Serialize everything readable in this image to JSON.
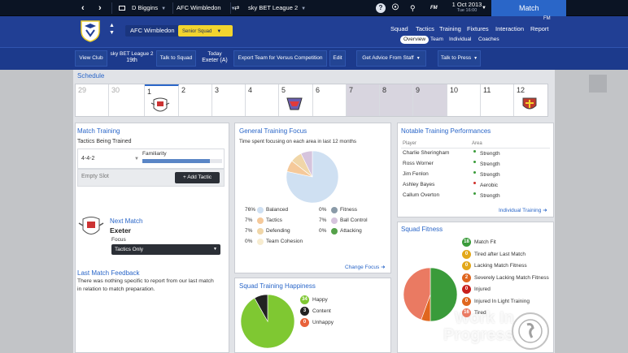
{
  "topbar": {
    "back_icon": "chevron-left-icon",
    "forward_icon": "chevron-right-icon",
    "manager": "D Biggins",
    "club": "AFC Wimbledon",
    "league": "sky BET League 2",
    "help": "?",
    "date": "1 Oct 2013",
    "day": "Tue 16:00",
    "match_button": "Match"
  },
  "header": {
    "club_pill": "AFC Wimbledon",
    "squad_pill": "Senior Squad",
    "menu": [
      "Squad",
      "Tactics",
      "Training",
      "Fixtures",
      "Interaction",
      "Report"
    ],
    "submenu": [
      "Overview",
      "Team",
      "Individual",
      "Coaches"
    ],
    "fm_badge": "FM"
  },
  "toolbar": {
    "view_club": "View Club",
    "league_name": "sky BET League 2",
    "league_pos": "19th",
    "talk_to_squad": "Talk to Squad",
    "today_label": "Today",
    "today_value": "Exeter (A)",
    "export_team": "Export Team for Versus Competition",
    "edit": "Edit",
    "advice": "Get Advice From Staff",
    "talk_press": "Talk to Press"
  },
  "schedule": {
    "title": "Schedule",
    "days": [
      "29",
      "30",
      "1",
      "2",
      "3",
      "4",
      "5",
      "6",
      "7",
      "8",
      "9",
      "10",
      "11",
      "12"
    ]
  },
  "match_training": {
    "title": "Match Training",
    "subtitle": "Tactics Being Trained",
    "formation": "4-4-2",
    "familiarity_label": "Familiarity",
    "familiarity": 0.85,
    "empty_slot": "Empty Slot",
    "add_tactic": "Add Tactic",
    "next_match_title": "Next Match",
    "next_opponent": "Exeter",
    "focus_label": "Focus",
    "focus_value": "Tactics Only",
    "last_feedback_title": "Last Match Feedback",
    "last_feedback_text1": "There was nothing specific to report from our last match",
    "last_feedback_text2": "in relation to match preparation."
  },
  "general_focus": {
    "title": "General Training Focus",
    "subtitle": "Time spent focusing on each area in last 12 months",
    "items": [
      {
        "pct": "76%",
        "label": "Balanced",
        "color": "#cfe0f2"
      },
      {
        "pct": "7%",
        "label": "Tactics",
        "color": "#f5c99a"
      },
      {
        "pct": "7%",
        "label": "Defending",
        "color": "#f0d6a8"
      },
      {
        "pct": "0%",
        "label": "Team Cohesion",
        "color": "#f7ecd0"
      },
      {
        "pct": "0%",
        "label": "Fitness",
        "color": "#8a9aa8"
      },
      {
        "pct": "7%",
        "label": "Ball Control",
        "color": "#d6c4dd"
      },
      {
        "pct": "0%",
        "label": "Attacking",
        "color": "#55a14a"
      }
    ],
    "change_focus": "Change Focus"
  },
  "happiness": {
    "title": "Squad Training Happiness",
    "items": [
      {
        "count": "34",
        "label": "Happy",
        "color": "#7fc832"
      },
      {
        "count": "3",
        "label": "Content",
        "color": "#222222"
      },
      {
        "count": "0",
        "label": "Unhappy",
        "color": "#e8623a"
      }
    ]
  },
  "notable": {
    "title": "Notable Training Performances",
    "col_player": "Player",
    "col_area": "Area",
    "rows": [
      {
        "player": "Charlie Sheringham",
        "area": "Strength",
        "color": "#3a9b3a"
      },
      {
        "player": "Ross Worner",
        "area": "Strength",
        "color": "#3a9b3a"
      },
      {
        "player": "Jim Fenlon",
        "area": "Strength",
        "color": "#3a9b3a"
      },
      {
        "player": "Ashley Bayes",
        "area": "Aerobic",
        "color": "#d0302a"
      },
      {
        "player": "Callum Overton",
        "area": "Strength",
        "color": "#3a9b3a"
      }
    ],
    "individual_training": "Individual Training"
  },
  "fitness": {
    "title": "Squad Fitness",
    "items": [
      {
        "count": "18",
        "label": "Match Fit",
        "color": "#3a9b3a"
      },
      {
        "count": "0",
        "label": "Tired after Last Match",
        "color": "#e3a81a"
      },
      {
        "count": "0",
        "label": "Lacking Match Fitness",
        "color": "#e3a81a"
      },
      {
        "count": "2",
        "label": "Severely Lacking Match Fitness",
        "color": "#e0661e"
      },
      {
        "count": "0",
        "label": "Injured",
        "color": "#c8201c"
      },
      {
        "count": "0",
        "label": "Injured In Light Training",
        "color": "#e0661e"
      },
      {
        "count": "16",
        "label": "Tired",
        "color": "#ea7a62"
      }
    ]
  },
  "watermark": {
    "line1": "Work In",
    "line2": "Progress"
  }
}
